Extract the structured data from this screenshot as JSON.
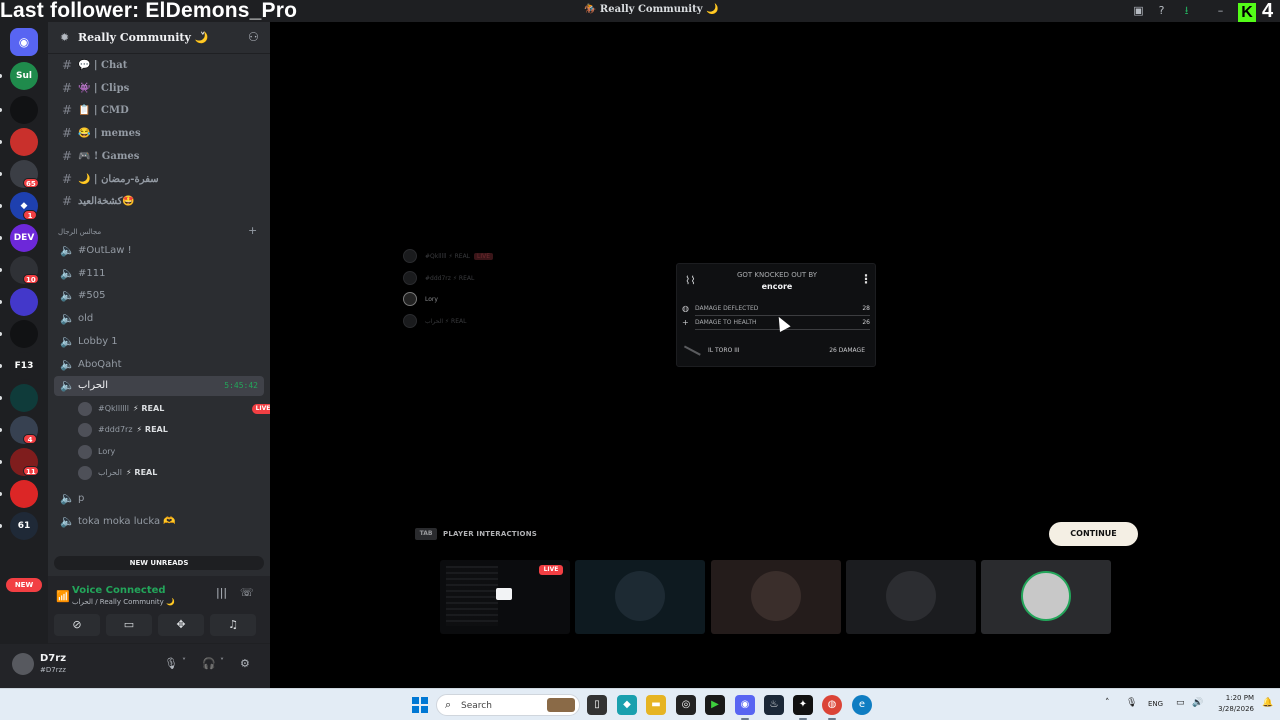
{
  "overlay": {
    "follower_text": "Last follower: ElDemons_Pro",
    "kick_count": "4"
  },
  "window": {
    "title": "🏇 Really Community 🌙"
  },
  "rail": {
    "servers": [
      {
        "label": "Sul",
        "color": "#1f8b4c"
      },
      {
        "label": "",
        "color": "#111214"
      },
      {
        "label": "",
        "color": "#c9302c"
      },
      {
        "label": "",
        "color": "#3b3e45",
        "badge": "65"
      },
      {
        "label": "◆",
        "color": "#1e40af",
        "badge": "1"
      },
      {
        "label": "DEV",
        "color": "#6d28d9"
      },
      {
        "label": "",
        "color": "#2f3136",
        "badge": "10"
      },
      {
        "label": "",
        "color": "#4338ca"
      },
      {
        "label": "",
        "color": "#111214"
      },
      {
        "label": "F13",
        "color": "#1e1f22"
      },
      {
        "label": "",
        "color": "#0f3b3a"
      },
      {
        "label": "",
        "color": "#374151",
        "badge": "4"
      },
      {
        "label": "",
        "color": "#7f1d1d",
        "badge": "11"
      },
      {
        "label": "",
        "color": "#dc2626"
      },
      {
        "label": "61",
        "color": "#1f2937"
      }
    ],
    "new_label": "NEW"
  },
  "sidebar": {
    "guild_name": "Really Community 🌙",
    "text_channels": [
      {
        "sym": "#",
        "name": "💬 | Chat"
      },
      {
        "sym": "#",
        "name": "👾 | Clips"
      },
      {
        "sym": "#",
        "name": "📋 | CMD"
      },
      {
        "sym": "#",
        "name": "😂 | memes"
      },
      {
        "sym": "#",
        "name": "🎮 ! Games"
      },
      {
        "sym": "#",
        "name": "🌙 | سفرة-رمضان"
      },
      {
        "sym": "#",
        "name": "كشخةالعيد🤩"
      }
    ],
    "category": "مجالس الرجال",
    "voice_channels": [
      {
        "name": "#OutLaw !"
      },
      {
        "name": "#111"
      },
      {
        "name": "#505"
      },
      {
        "name": "old"
      },
      {
        "name": "Lobby 1"
      },
      {
        "name": "AboQaht"
      }
    ],
    "active_voice": {
      "name": "الحراب",
      "timer": "5:45:42"
    },
    "voice_users": [
      {
        "name": "#Qkllllll",
        "tag": "⚡ REAL",
        "live": "LIVE",
        "icon": "⛶"
      },
      {
        "name": "#ddd7rz",
        "tag": "⚡ REAL",
        "icon": "🔧"
      },
      {
        "name": "Lory",
        "tag": "",
        "icon": "💬"
      },
      {
        "name": "الحراب",
        "tag": "⚡ REAL",
        "icon": "🎮"
      }
    ],
    "extra_voice": [
      {
        "name": "p"
      },
      {
        "name": "toka moka lucka 🫶"
      }
    ],
    "new_unreads": "NEW UNREADS"
  },
  "voice_panel": {
    "title": "Voice Connected",
    "subtitle": "الحراب / Really Community 🌙"
  },
  "user_panel": {
    "name": "D7rz",
    "tag": "#D7rzz"
  },
  "stream": {
    "ghost_players": [
      {
        "name": "#Qklllll",
        "tag": "⚡ REAL",
        "live": "LIVE"
      },
      {
        "name": "#ddd7rz",
        "tag": "⚡ REAL"
      },
      {
        "name": "Lory",
        "tag": ""
      },
      {
        "name": "الحراب",
        "tag": "⚡ REAL"
      }
    ],
    "knockout": {
      "heading": "GOT KNOCKED OUT BY",
      "name": "encore",
      "rows": [
        {
          "icon": "◍",
          "label": "DAMAGE DEFLECTED",
          "value": "28"
        },
        {
          "icon": "+",
          "label": "DAMAGE TO HEALTH",
          "value": "26"
        }
      ],
      "weapon": "IL TORO III",
      "damage": "26 DAMAGE"
    },
    "tab_key": "TAB",
    "player_interactions": "PLAYER INTERACTIONS",
    "continue": "CONTINUE",
    "tile_live": "LIVE"
  },
  "taskbar": {
    "search_placeholder": "Search",
    "lang": "ENG",
    "time": "1:20 PM",
    "date": "3/28/2026"
  }
}
